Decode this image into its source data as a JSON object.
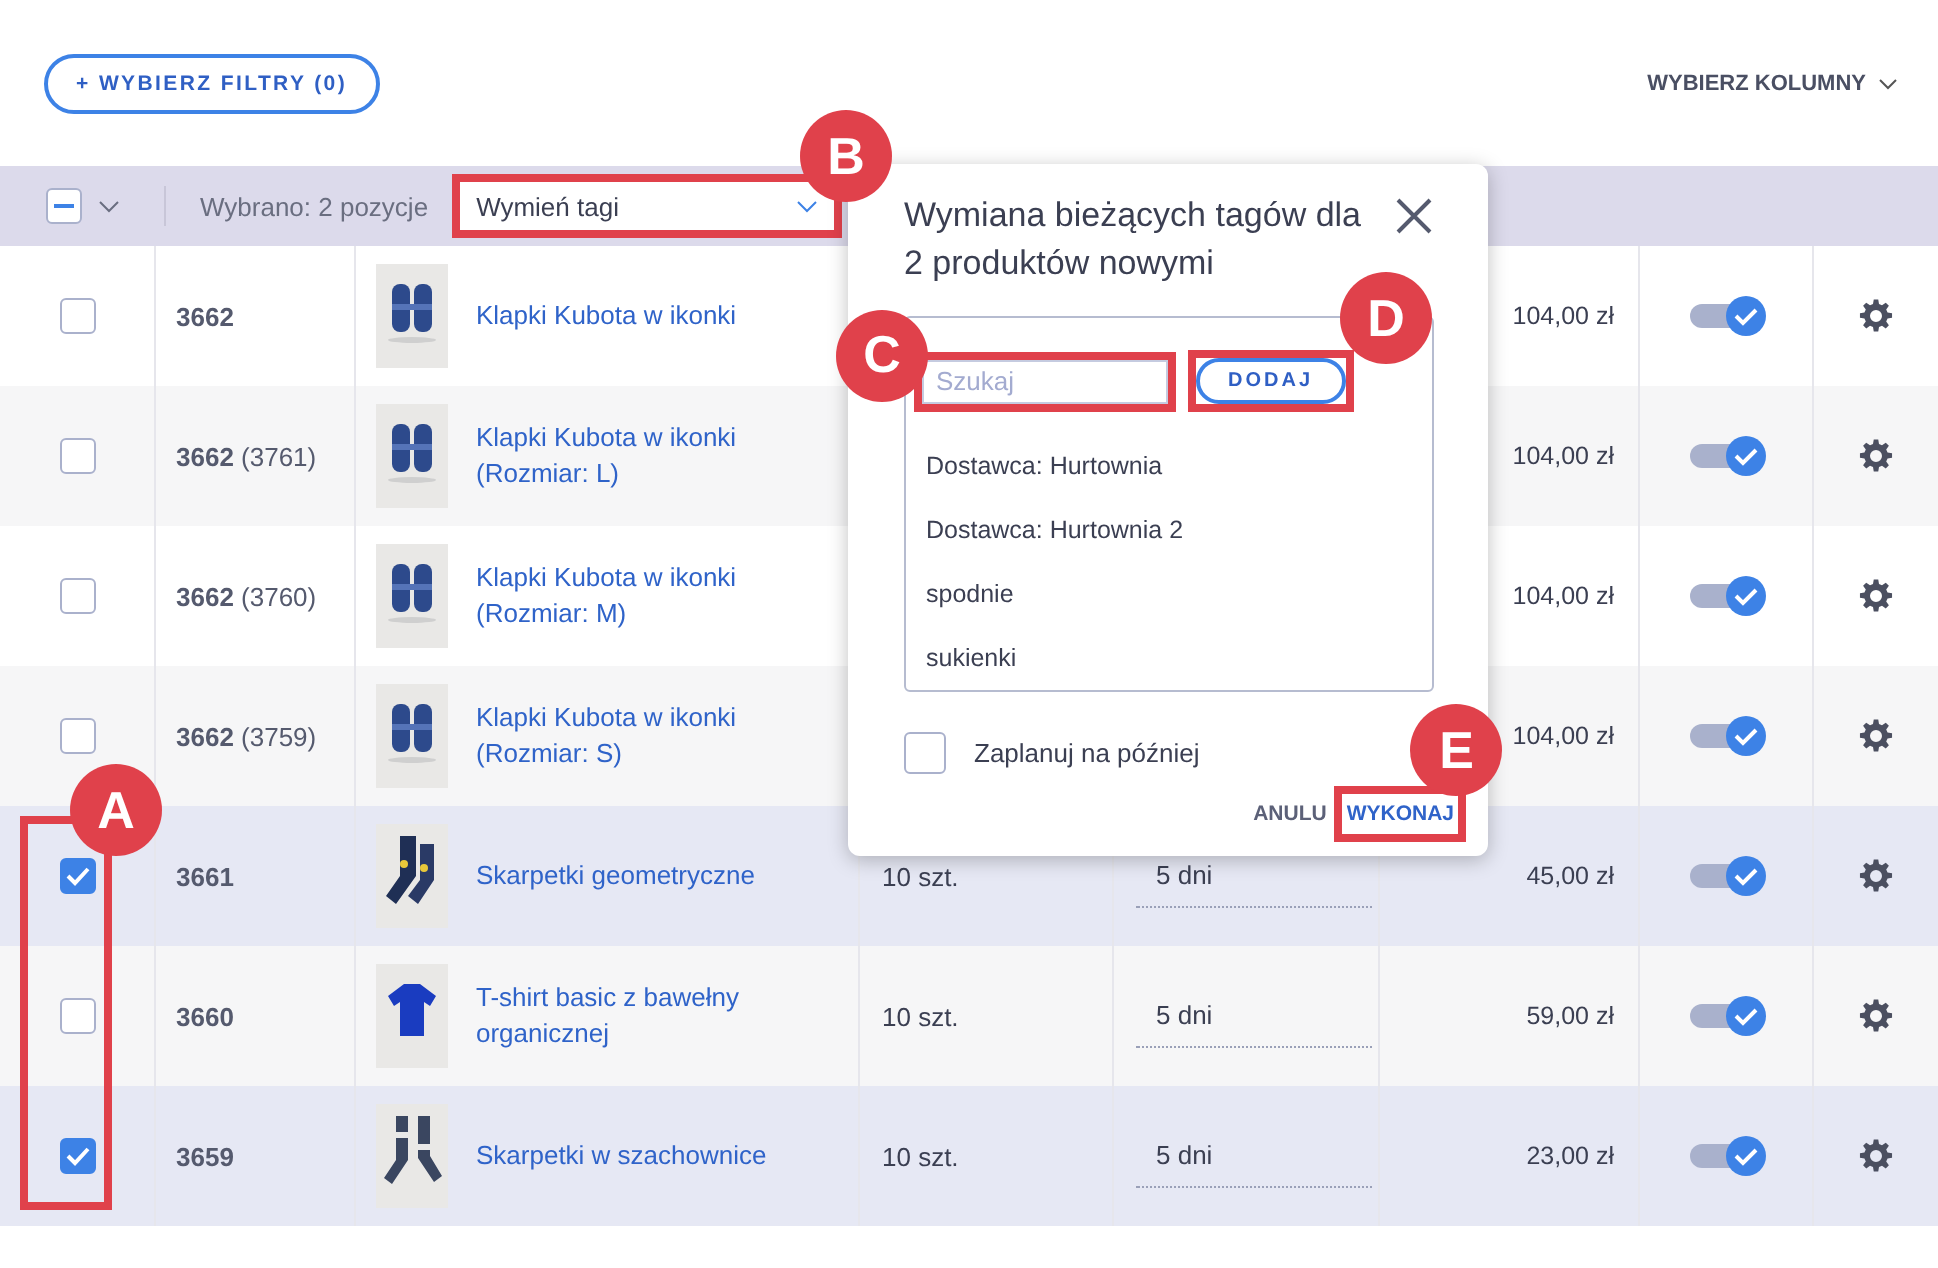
{
  "filters_button": "+ WYBIERZ FILTRY (0)",
  "columns_button": "WYBIERZ KOLUMNY",
  "toolbar": {
    "bulk_checkbox_indeterminate": true,
    "selection_text": "Wybrano: 2 pozycje",
    "action_select": "Wymień tagi"
  },
  "rows": [
    {
      "selected": false,
      "id": "**3662**",
      "name": "Klapki Kubota w ikonki",
      "price": "104,00 zł",
      "on": true
    },
    {
      "selected": false,
      "id": "**3662** (3761)",
      "name": "Klapki Kubota w ikonki",
      "variant": "(Rozmiar: L)",
      "price": "104,00 zł",
      "on": true
    },
    {
      "selected": false,
      "id": "**3662** (3760)",
      "name": "Klapki Kubota w ikonki",
      "variant": "(Rozmiar: M)",
      "price": "104,00 zł",
      "on": true
    },
    {
      "selected": false,
      "id": "**3662** (3759)",
      "name": "Klapki Kubota w ikonki",
      "variant": "(Rozmiar: S)",
      "price": "104,00 zł",
      "on": true
    },
    {
      "selected": true,
      "id": "**3661**",
      "name": "Skarpetki geometryczne",
      "quantity": "10 szt.",
      "days": "5 dni",
      "price": "45,00 zł",
      "on": true
    },
    {
      "selected": false,
      "id": "**3660**",
      "name": "T-shirt basic z bawełny organicznej",
      "quantity": "10 szt.",
      "days": "5 dni",
      "price": "59,00 zł",
      "on": true
    },
    {
      "selected": true,
      "id": "**3659**",
      "name": "Skarpetki w szachownice",
      "quantity": "10 szt.",
      "days": "5 dni",
      "price": "23,00 zł",
      "on": true
    }
  ],
  "dialog": {
    "title": "Wymiana bieżących tagów dla 2 produktów nowymi",
    "search_placeholder": "Szukaj",
    "add_button": "DODAJ",
    "tags": [
      "Dostawca: Hurtownia",
      "Dostawca: Hurtownia 2",
      "spodnie",
      "sukienki"
    ],
    "schedule": {
      "label": "Zaplanuj na później",
      "checked": false
    },
    "cancel_button": "ANULU",
    "confirm_button": "WYKONAJ"
  },
  "annotations": [
    {
      "label": "A"
    },
    {
      "label": "B"
    },
    {
      "label": "C"
    },
    {
      "label": "D"
    },
    {
      "label": "E"
    }
  ]
}
